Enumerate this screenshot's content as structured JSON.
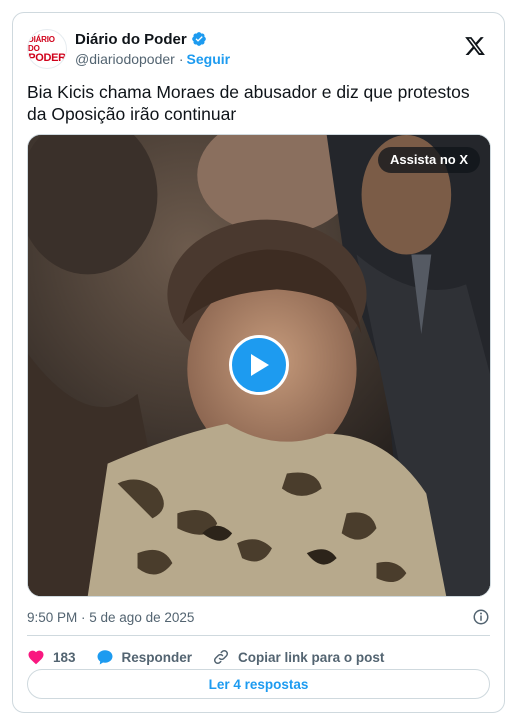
{
  "author": {
    "avatar_text_line1": "DIÁRIO DO",
    "avatar_text_line2": "PODER",
    "display_name": "Diário do Poder",
    "handle": "@diariodopoder",
    "separator": "·",
    "follow_label": "Seguir",
    "verified": true
  },
  "tweet": {
    "text": "Bia Kicis chama Moraes de abusador e diz que protestos da Oposição irão continuar",
    "watch_label": "Assista no X",
    "timestamp": "9:50 PM · 5 de ago de 2025"
  },
  "actions": {
    "likes": "183",
    "reply_label": "Responder",
    "copy_label": "Copiar link para o post"
  },
  "replies_button": "Ler 4 respostas",
  "colors": {
    "accent": "#1d9bf0",
    "like": "#f91880",
    "brand_red": "#d0021b"
  },
  "icons": [
    "verified-badge-icon",
    "x-logo-icon",
    "play-icon",
    "info-icon",
    "heart-icon",
    "reply-bubble-icon",
    "link-icon"
  ]
}
